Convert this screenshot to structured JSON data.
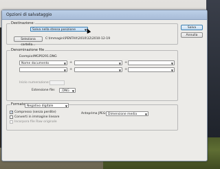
{
  "dialog": {
    "title": "Opzioni di salvataggio"
  },
  "destination": {
    "legend": "Destinazione:",
    "value": "Salva nella stessa posizione",
    "select_folder_button": "Seleziona cartella...",
    "path": "C:\\Immagini\\PENTAX\\2010\\12\\2010-12-19"
  },
  "file_naming": {
    "legend": "Denominazione file",
    "example_label": "Esempio:",
    "example_value": "IMGP0291.DNG",
    "first_field_value": "Nome documento",
    "begin_number_label": "Inizio numerazione:",
    "extension_label": "Estensione file:",
    "extension_value": ".DNG",
    "plus": "+"
  },
  "format": {
    "legend": "Formato:",
    "value": "Negativo digitale",
    "compress_label": "Compresso (senza perdite)",
    "convert_linear_label": "Converti in immagine lineare",
    "embed_raw_label": "Incorpora file Raw originale",
    "jpeg_preview_label": "Anteprima JPEG:",
    "jpeg_preview_value": "Dimensione media"
  },
  "buttons": {
    "save": "Salva",
    "cancel": "Annulla"
  }
}
